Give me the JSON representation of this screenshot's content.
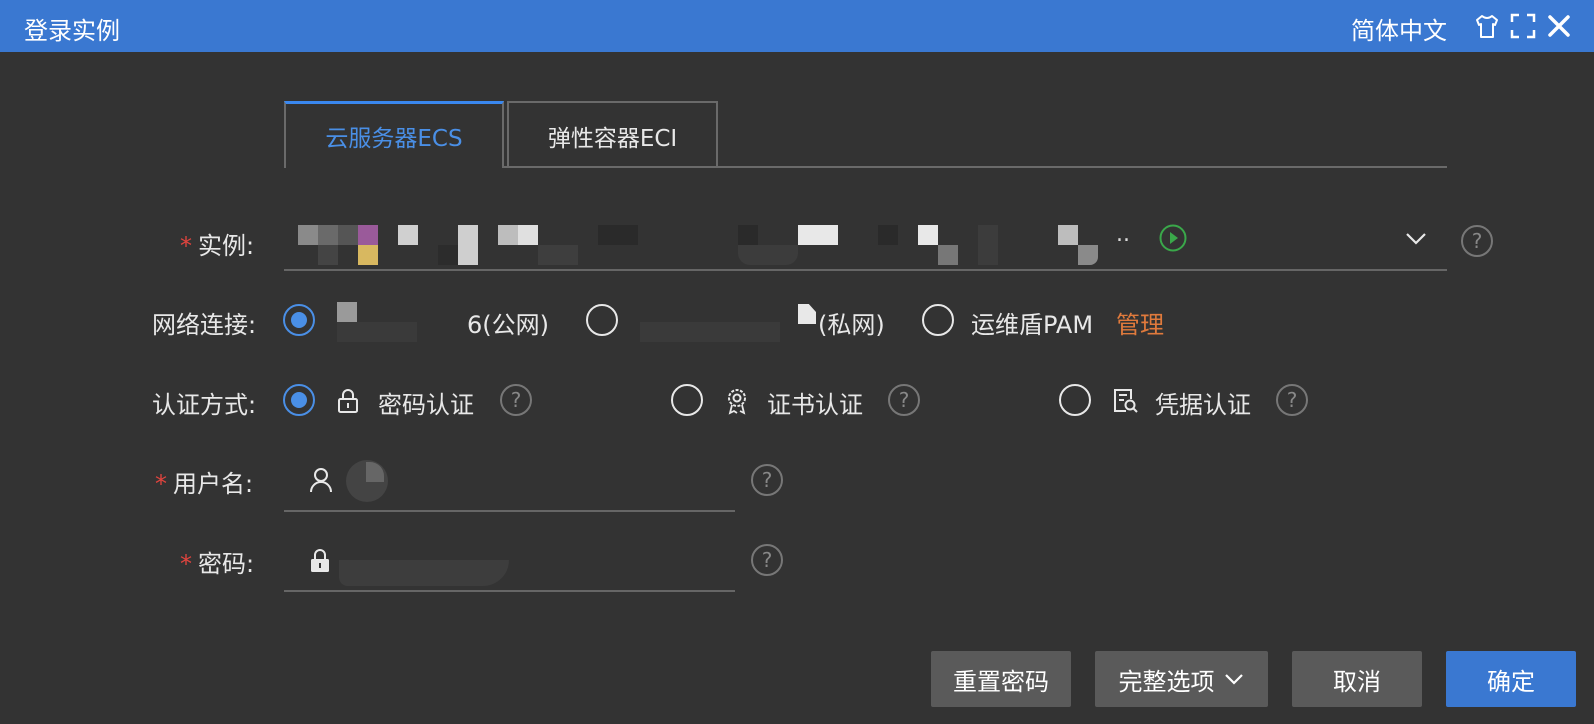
{
  "window": {
    "title": "登录实例",
    "language": "简体中文"
  },
  "tabs": [
    {
      "label": "云服务器ECS",
      "active": true
    },
    {
      "label": "弹性容器ECI",
      "active": false
    }
  ],
  "form": {
    "instance_label": "实例",
    "network_label": "网络连接",
    "auth_label": "认证方式",
    "username_label": "用户名",
    "password_label": "密码",
    "required_mark": "*",
    "colon": ":"
  },
  "network": {
    "public_suffix": "6(公网)",
    "private_suffix": "(私网)",
    "pam_label": "运维盾PAM",
    "pam_manage": "管理",
    "selected": "public"
  },
  "auth": {
    "password": "密码认证",
    "certificate": "证书认证",
    "credential": "凭据认证",
    "selected": "password"
  },
  "instance_ellipsis": "..",
  "help_glyph": "?",
  "buttons": {
    "reset_password": "重置密码",
    "full_options": "完整选项",
    "cancel": "取消",
    "confirm": "确定"
  },
  "icons": {
    "shirt": "shirt-icon",
    "fullscreen": "fullscreen-icon",
    "close": "close-icon",
    "play": "play-circle-icon",
    "chevron": "chevron-down-icon",
    "lock": "lock-icon",
    "certificate": "certificate-icon",
    "credential": "credential-icon",
    "user": "user-icon"
  },
  "colors": {
    "titlebar": "#3a78d1",
    "background": "#333333",
    "accent": "#4a8fe6",
    "required": "#e0443e",
    "link": "#e07a3c",
    "play": "#3aa84a"
  }
}
